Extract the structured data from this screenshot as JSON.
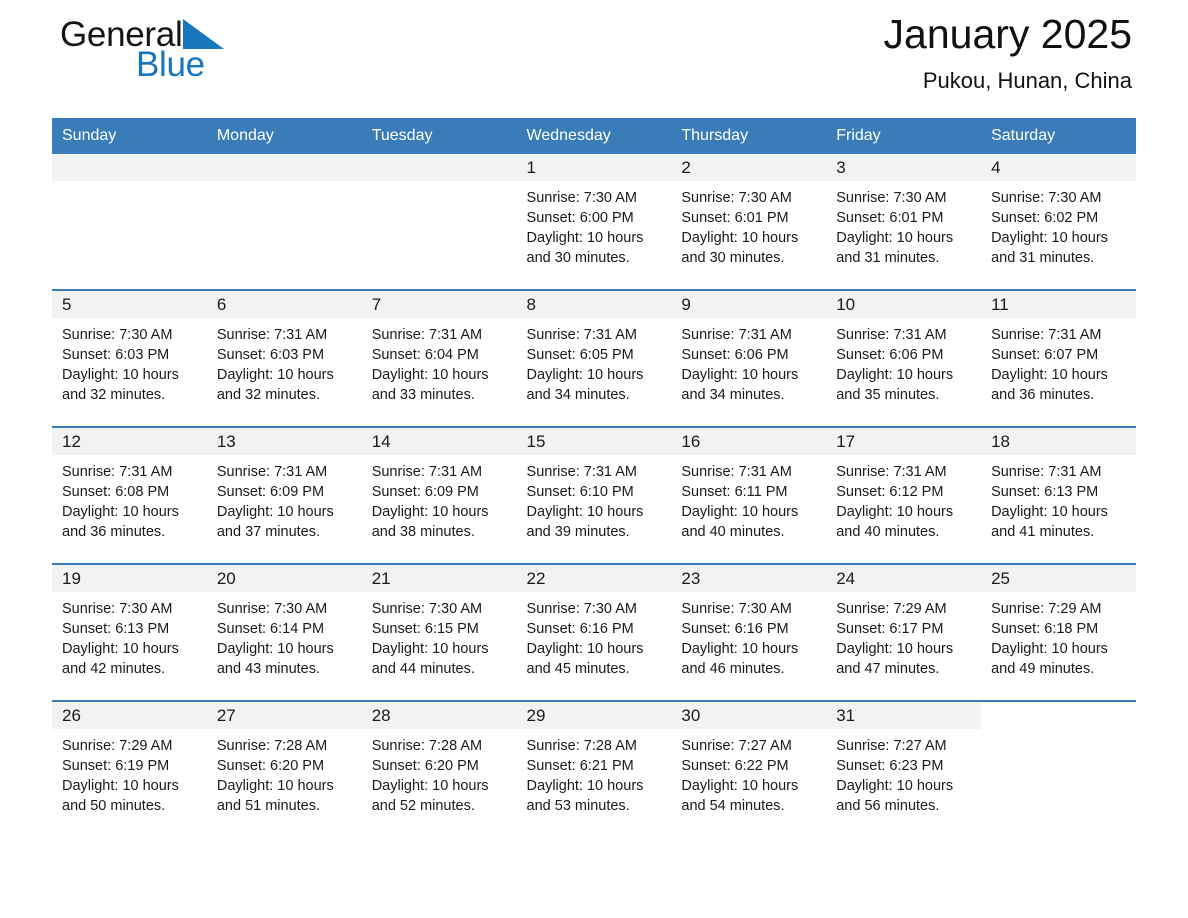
{
  "brand": {
    "name_part1": "General",
    "name_part2": "Blue",
    "logo_icon": "triangle-logo-icon",
    "accent_color": "#1876bc"
  },
  "header": {
    "title": "January 2025",
    "location": "Pukou, Hunan, China"
  },
  "theme": {
    "header_blue": "#3a7cb8",
    "band_gray": "#f2f2f2",
    "text_color": "#1a1a1a"
  },
  "calendar": {
    "day_headers": [
      "Sunday",
      "Monday",
      "Tuesday",
      "Wednesday",
      "Thursday",
      "Friday",
      "Saturday"
    ],
    "weeks": [
      [
        {
          "day": "",
          "sunrise": "",
          "sunset": "",
          "daylight1": "",
          "daylight2": "",
          "empty": true
        },
        {
          "day": "",
          "sunrise": "",
          "sunset": "",
          "daylight1": "",
          "daylight2": "",
          "empty": true
        },
        {
          "day": "",
          "sunrise": "",
          "sunset": "",
          "daylight1": "",
          "daylight2": "",
          "empty": true
        },
        {
          "day": "1",
          "sunrise": "Sunrise: 7:30 AM",
          "sunset": "Sunset: 6:00 PM",
          "daylight1": "Daylight: 10 hours",
          "daylight2": "and 30 minutes.",
          "empty": false
        },
        {
          "day": "2",
          "sunrise": "Sunrise: 7:30 AM",
          "sunset": "Sunset: 6:01 PM",
          "daylight1": "Daylight: 10 hours",
          "daylight2": "and 30 minutes.",
          "empty": false
        },
        {
          "day": "3",
          "sunrise": "Sunrise: 7:30 AM",
          "sunset": "Sunset: 6:01 PM",
          "daylight1": "Daylight: 10 hours",
          "daylight2": "and 31 minutes.",
          "empty": false
        },
        {
          "day": "4",
          "sunrise": "Sunrise: 7:30 AM",
          "sunset": "Sunset: 6:02 PM",
          "daylight1": "Daylight: 10 hours",
          "daylight2": "and 31 minutes.",
          "empty": false
        }
      ],
      [
        {
          "day": "5",
          "sunrise": "Sunrise: 7:30 AM",
          "sunset": "Sunset: 6:03 PM",
          "daylight1": "Daylight: 10 hours",
          "daylight2": "and 32 minutes.",
          "empty": false
        },
        {
          "day": "6",
          "sunrise": "Sunrise: 7:31 AM",
          "sunset": "Sunset: 6:03 PM",
          "daylight1": "Daylight: 10 hours",
          "daylight2": "and 32 minutes.",
          "empty": false
        },
        {
          "day": "7",
          "sunrise": "Sunrise: 7:31 AM",
          "sunset": "Sunset: 6:04 PM",
          "daylight1": "Daylight: 10 hours",
          "daylight2": "and 33 minutes.",
          "empty": false
        },
        {
          "day": "8",
          "sunrise": "Sunrise: 7:31 AM",
          "sunset": "Sunset: 6:05 PM",
          "daylight1": "Daylight: 10 hours",
          "daylight2": "and 34 minutes.",
          "empty": false
        },
        {
          "day": "9",
          "sunrise": "Sunrise: 7:31 AM",
          "sunset": "Sunset: 6:06 PM",
          "daylight1": "Daylight: 10 hours",
          "daylight2": "and 34 minutes.",
          "empty": false
        },
        {
          "day": "10",
          "sunrise": "Sunrise: 7:31 AM",
          "sunset": "Sunset: 6:06 PM",
          "daylight1": "Daylight: 10 hours",
          "daylight2": "and 35 minutes.",
          "empty": false
        },
        {
          "day": "11",
          "sunrise": "Sunrise: 7:31 AM",
          "sunset": "Sunset: 6:07 PM",
          "daylight1": "Daylight: 10 hours",
          "daylight2": "and 36 minutes.",
          "empty": false
        }
      ],
      [
        {
          "day": "12",
          "sunrise": "Sunrise: 7:31 AM",
          "sunset": "Sunset: 6:08 PM",
          "daylight1": "Daylight: 10 hours",
          "daylight2": "and 36 minutes.",
          "empty": false
        },
        {
          "day": "13",
          "sunrise": "Sunrise: 7:31 AM",
          "sunset": "Sunset: 6:09 PM",
          "daylight1": "Daylight: 10 hours",
          "daylight2": "and 37 minutes.",
          "empty": false
        },
        {
          "day": "14",
          "sunrise": "Sunrise: 7:31 AM",
          "sunset": "Sunset: 6:09 PM",
          "daylight1": "Daylight: 10 hours",
          "daylight2": "and 38 minutes.",
          "empty": false
        },
        {
          "day": "15",
          "sunrise": "Sunrise: 7:31 AM",
          "sunset": "Sunset: 6:10 PM",
          "daylight1": "Daylight: 10 hours",
          "daylight2": "and 39 minutes.",
          "empty": false
        },
        {
          "day": "16",
          "sunrise": "Sunrise: 7:31 AM",
          "sunset": "Sunset: 6:11 PM",
          "daylight1": "Daylight: 10 hours",
          "daylight2": "and 40 minutes.",
          "empty": false
        },
        {
          "day": "17",
          "sunrise": "Sunrise: 7:31 AM",
          "sunset": "Sunset: 6:12 PM",
          "daylight1": "Daylight: 10 hours",
          "daylight2": "and 40 minutes.",
          "empty": false
        },
        {
          "day": "18",
          "sunrise": "Sunrise: 7:31 AM",
          "sunset": "Sunset: 6:13 PM",
          "daylight1": "Daylight: 10 hours",
          "daylight2": "and 41 minutes.",
          "empty": false
        }
      ],
      [
        {
          "day": "19",
          "sunrise": "Sunrise: 7:30 AM",
          "sunset": "Sunset: 6:13 PM",
          "daylight1": "Daylight: 10 hours",
          "daylight2": "and 42 minutes.",
          "empty": false
        },
        {
          "day": "20",
          "sunrise": "Sunrise: 7:30 AM",
          "sunset": "Sunset: 6:14 PM",
          "daylight1": "Daylight: 10 hours",
          "daylight2": "and 43 minutes.",
          "empty": false
        },
        {
          "day": "21",
          "sunrise": "Sunrise: 7:30 AM",
          "sunset": "Sunset: 6:15 PM",
          "daylight1": "Daylight: 10 hours",
          "daylight2": "and 44 minutes.",
          "empty": false
        },
        {
          "day": "22",
          "sunrise": "Sunrise: 7:30 AM",
          "sunset": "Sunset: 6:16 PM",
          "daylight1": "Daylight: 10 hours",
          "daylight2": "and 45 minutes.",
          "empty": false
        },
        {
          "day": "23",
          "sunrise": "Sunrise: 7:30 AM",
          "sunset": "Sunset: 6:16 PM",
          "daylight1": "Daylight: 10 hours",
          "daylight2": "and 46 minutes.",
          "empty": false
        },
        {
          "day": "24",
          "sunrise": "Sunrise: 7:29 AM",
          "sunset": "Sunset: 6:17 PM",
          "daylight1": "Daylight: 10 hours",
          "daylight2": "and 47 minutes.",
          "empty": false
        },
        {
          "day": "25",
          "sunrise": "Sunrise: 7:29 AM",
          "sunset": "Sunset: 6:18 PM",
          "daylight1": "Daylight: 10 hours",
          "daylight2": "and 49 minutes.",
          "empty": false
        }
      ],
      [
        {
          "day": "26",
          "sunrise": "Sunrise: 7:29 AM",
          "sunset": "Sunset: 6:19 PM",
          "daylight1": "Daylight: 10 hours",
          "daylight2": "and 50 minutes.",
          "empty": false
        },
        {
          "day": "27",
          "sunrise": "Sunrise: 7:28 AM",
          "sunset": "Sunset: 6:20 PM",
          "daylight1": "Daylight: 10 hours",
          "daylight2": "and 51 minutes.",
          "empty": false
        },
        {
          "day": "28",
          "sunrise": "Sunrise: 7:28 AM",
          "sunset": "Sunset: 6:20 PM",
          "daylight1": "Daylight: 10 hours",
          "daylight2": "and 52 minutes.",
          "empty": false
        },
        {
          "day": "29",
          "sunrise": "Sunrise: 7:28 AM",
          "sunset": "Sunset: 6:21 PM",
          "daylight1": "Daylight: 10 hours",
          "daylight2": "and 53 minutes.",
          "empty": false
        },
        {
          "day": "30",
          "sunrise": "Sunrise: 7:27 AM",
          "sunset": "Sunset: 6:22 PM",
          "daylight1": "Daylight: 10 hours",
          "daylight2": "and 54 minutes.",
          "empty": false
        },
        {
          "day": "31",
          "sunrise": "Sunrise: 7:27 AM",
          "sunset": "Sunset: 6:23 PM",
          "daylight1": "Daylight: 10 hours",
          "daylight2": "and 56 minutes.",
          "empty": false
        },
        {
          "day": "",
          "sunrise": "",
          "sunset": "",
          "daylight1": "",
          "daylight2": "",
          "empty": true,
          "blank": true
        }
      ]
    ]
  }
}
